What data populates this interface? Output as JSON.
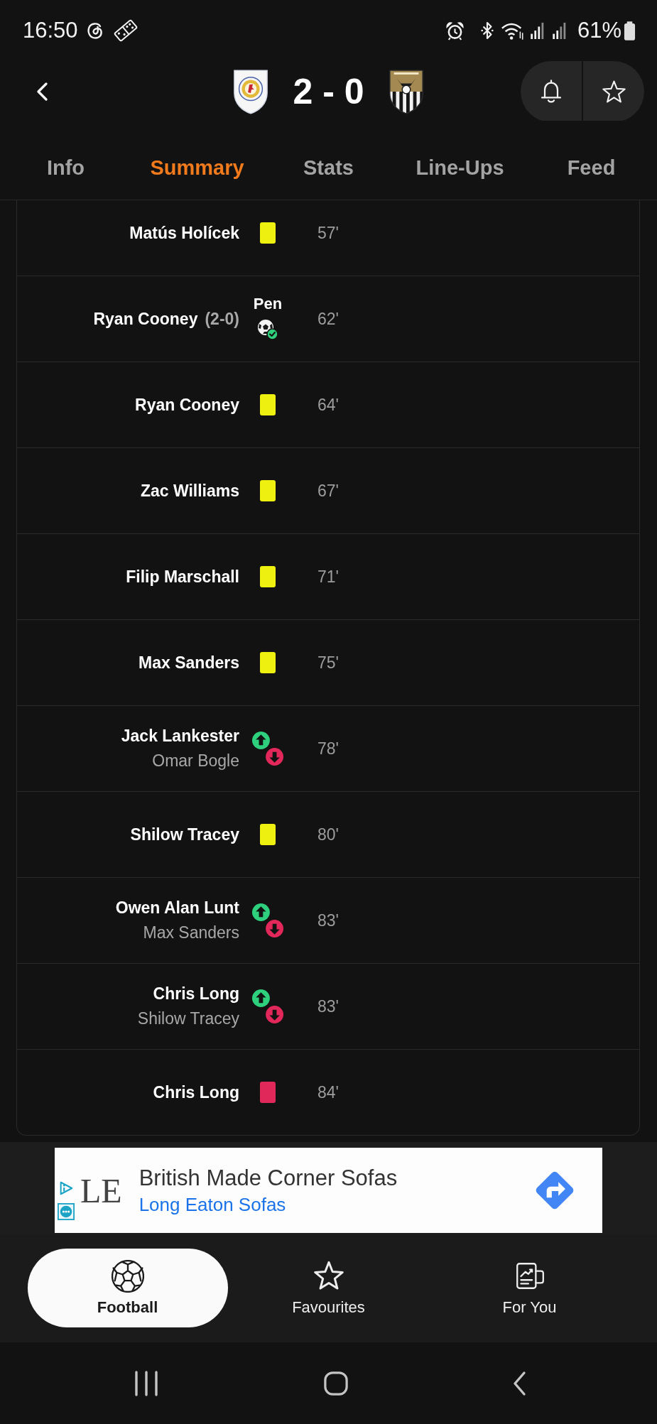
{
  "status_bar": {
    "time": "16:50",
    "battery": "61%"
  },
  "header": {
    "score": "2 - 0"
  },
  "tabs": [
    {
      "label": "Info",
      "selected": false
    },
    {
      "label": "Summary",
      "selected": true
    },
    {
      "label": "Stats",
      "selected": false
    },
    {
      "label": "Line-Ups",
      "selected": false
    },
    {
      "label": "Feed",
      "selected": false
    }
  ],
  "events": [
    {
      "kind": "yellow_card",
      "player": "Matús Holícek",
      "minute": "57'"
    },
    {
      "kind": "goal",
      "player": "Ryan Cooney",
      "score": "(2-0)",
      "goal_type": "Pen",
      "minute": "62'"
    },
    {
      "kind": "yellow_card",
      "player": "Ryan Cooney",
      "minute": "64'"
    },
    {
      "kind": "yellow_card",
      "player": "Zac Williams",
      "minute": "67'"
    },
    {
      "kind": "yellow_card",
      "player": "Filip Marschall",
      "minute": "71'"
    },
    {
      "kind": "yellow_card",
      "player": "Max Sanders",
      "minute": "75'"
    },
    {
      "kind": "substitution",
      "player_in": "Jack Lankester",
      "player_out": "Omar Bogle",
      "minute": "78'"
    },
    {
      "kind": "yellow_card",
      "player": "Shilow Tracey",
      "minute": "80'"
    },
    {
      "kind": "substitution",
      "player_in": "Owen Alan Lunt",
      "player_out": "Max Sanders",
      "minute": "83'"
    },
    {
      "kind": "substitution",
      "player_in": "Chris Long",
      "player_out": "Shilow Tracey",
      "minute": "83'"
    },
    {
      "kind": "red_card",
      "player": "Chris Long",
      "minute": "84'"
    }
  ],
  "ad": {
    "logo": "LE",
    "headline": "British Made Corner Sofas",
    "advertiser": "Long Eaton Sofas"
  },
  "bottom_nav": [
    {
      "label": "Football",
      "selected": true
    },
    {
      "label": "Favourites",
      "selected": false
    },
    {
      "label": "For You",
      "selected": false
    }
  ]
}
